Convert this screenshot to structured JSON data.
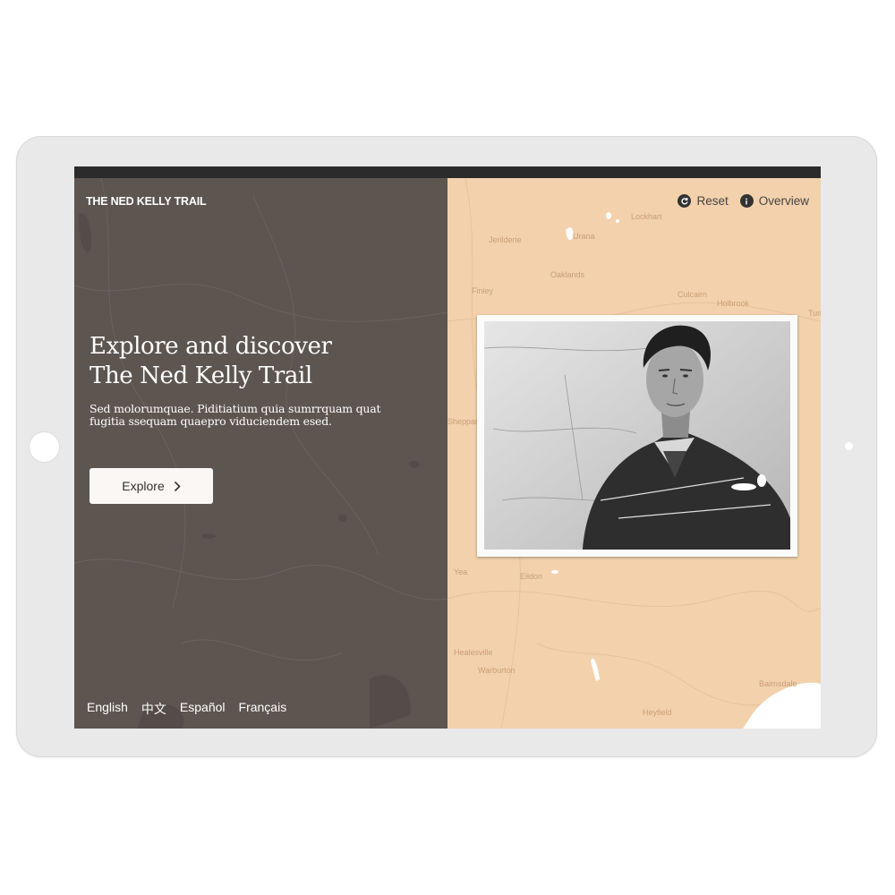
{
  "app": {
    "brand": "THE NED KELLY TRAIL"
  },
  "header": {
    "reset_label": "Reset",
    "overview_label": "Overview"
  },
  "hero": {
    "title_line1": "Explore and discover",
    "title_line2": "The Ned Kelly Trail",
    "subtitle": "Sed molorumquae. Piditiatium quia sumrrquam quat fugitia ssequam quaepro viduciendem esed.",
    "explore_label": "Explore"
  },
  "languages": [
    "English",
    "中文",
    "Español",
    "Français"
  ],
  "map": {
    "labels": [
      "Lockhart",
      "Jerilderie",
      "Urana",
      "Oaklands",
      "Finley",
      "Culcairn",
      "Holbrook",
      "Tumbarumba",
      "Shepparton",
      "Yea",
      "Eildon",
      "Healesville",
      "Warburton",
      "Heyfield",
      "Bairnsdale"
    ]
  },
  "colors": {
    "left_panel": "#5d5550",
    "right_panel": "#f2d1ac",
    "button_bg": "#faf7f4",
    "frame": "#e9e9e9"
  }
}
